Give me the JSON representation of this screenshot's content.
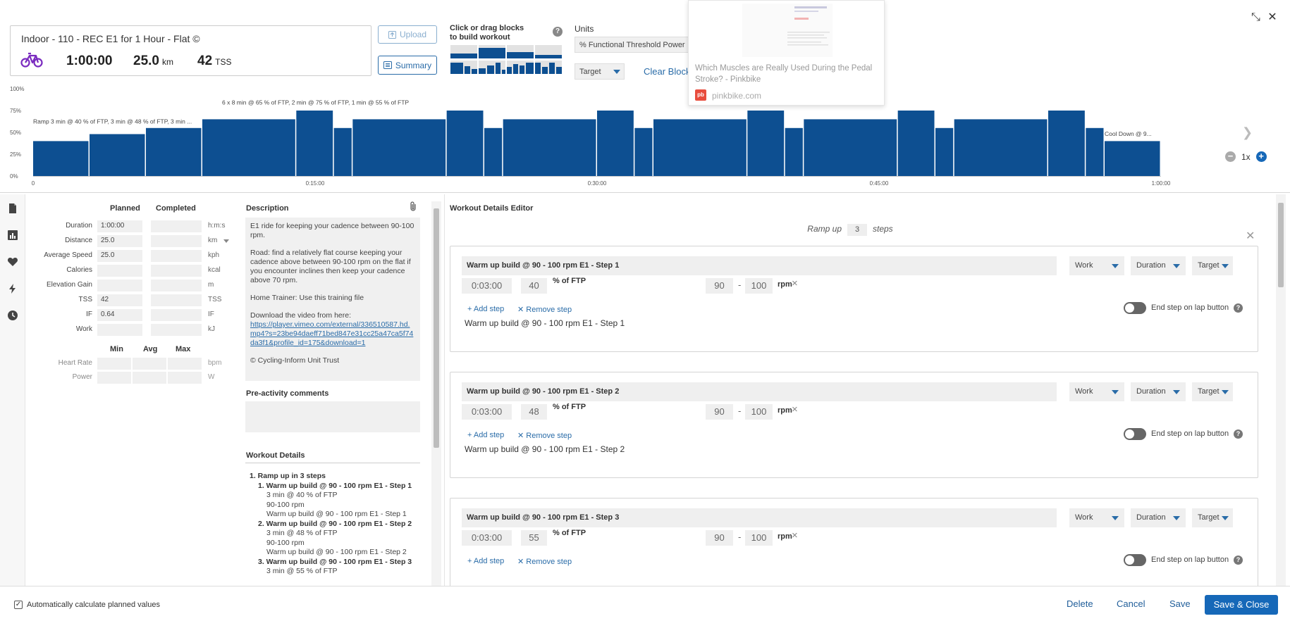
{
  "summary": {
    "title": "Indoor - 110 - REC E1 for 1 Hour - Flat ©",
    "duration": "1:00:00",
    "distance": "25.0",
    "distance_unit": "km",
    "tss": "42",
    "tss_unit": "TSS"
  },
  "toolbar": {
    "upload_label": "Upload",
    "summary_label": "Summary",
    "blocks_title_1": "Click or drag blocks",
    "blocks_title_2": "to build workout",
    "help": "?",
    "units_title": "Units",
    "units_value": "% Functional Threshold Power",
    "target_value": "Target",
    "clear_blocks": "Clear Blocks"
  },
  "link_preview": {
    "title": "Which Muscles are Really Used During the Pedal Stroke? - Pinkbike",
    "favicon": "pb",
    "domain": "pinkbike.com"
  },
  "window_icons": {
    "minimize": "⤡",
    "close": "✕"
  },
  "chart_data": {
    "type": "bar",
    "ylabel": "",
    "xlabel": "",
    "y_ticks": [
      "100%",
      "75%",
      "50%",
      "25%",
      "0%"
    ],
    "ylim": [
      0,
      100
    ],
    "xlim": [
      0,
      60
    ],
    "x_ticks": [
      {
        "v": 0,
        "label": "0"
      },
      {
        "v": 15,
        "label": "0:15:00"
      },
      {
        "v": 30,
        "label": "0:30:00"
      },
      {
        "v": 45,
        "label": "0:45:00"
      },
      {
        "v": 60,
        "label": "1:00:00"
      }
    ],
    "blocks": [
      {
        "start": 0,
        "end": 3,
        "value": 40
      },
      {
        "start": 3,
        "end": 6,
        "value": 48
      },
      {
        "start": 6,
        "end": 9,
        "value": 55
      },
      {
        "start": 9,
        "end": 14,
        "value": 65
      },
      {
        "start": 14,
        "end": 16,
        "value": 75
      },
      {
        "start": 16,
        "end": 17,
        "value": 55
      },
      {
        "start": 17,
        "end": 22,
        "value": 65
      },
      {
        "start": 22,
        "end": 24,
        "value": 75
      },
      {
        "start": 24,
        "end": 25,
        "value": 55
      },
      {
        "start": 25,
        "end": 30,
        "value": 65
      },
      {
        "start": 30,
        "end": 32,
        "value": 75
      },
      {
        "start": 32,
        "end": 33,
        "value": 55
      },
      {
        "start": 33,
        "end": 38,
        "value": 65
      },
      {
        "start": 38,
        "end": 40,
        "value": 75
      },
      {
        "start": 40,
        "end": 41,
        "value": 55
      },
      {
        "start": 41,
        "end": 46,
        "value": 65
      },
      {
        "start": 46,
        "end": 48,
        "value": 75
      },
      {
        "start": 48,
        "end": 49,
        "value": 55
      },
      {
        "start": 49,
        "end": 54,
        "value": 65
      },
      {
        "start": 54,
        "end": 56,
        "value": 75
      },
      {
        "start": 56,
        "end": 57,
        "value": 55
      },
      {
        "start": 57,
        "end": 60,
        "value": 40
      }
    ],
    "annotations": [
      {
        "text": "Ramp 3 min @ 40 % of FTP, 3 min @ 48 % of FTP, 3 min ...",
        "x": 0,
        "y": 60
      },
      {
        "text": "6 x 8 min @ 65 % of FTP, 2 min @ 75 % of FTP, 1 min @ 55 % of FTP",
        "x": 9,
        "y": 82
      },
      {
        "text": "Cool Down @ 9...",
        "x": 57,
        "y": 46
      }
    ],
    "zoom_label": "1x"
  },
  "stats": {
    "planned_head": "Planned",
    "completed_head": "Completed",
    "rows": [
      {
        "label": "Duration",
        "planned": "1:00:00",
        "unit": "h:m:s"
      },
      {
        "label": "Distance",
        "planned": "25.0",
        "unit": "km"
      },
      {
        "label": "Average Speed",
        "planned": "25.0",
        "unit": "kph"
      },
      {
        "label": "Calories",
        "planned": "",
        "unit": "kcal"
      },
      {
        "label": "Elevation Gain",
        "planned": "",
        "unit": "m"
      },
      {
        "label": "TSS",
        "planned": "42",
        "unit": "TSS"
      },
      {
        "label": "IF",
        "planned": "0.64",
        "unit": "IF"
      },
      {
        "label": "Work",
        "planned": "",
        "unit": "kJ"
      }
    ],
    "min_head": "Min",
    "avg_head": "Avg",
    "max_head": "Max",
    "hr_label": "Heart Rate",
    "hr_unit": "bpm",
    "power_label": "Power",
    "power_unit": "W"
  },
  "description": {
    "title": "Description",
    "p1": "E1 ride for keeping your cadence between 90-100 rpm.",
    "p2": "Road: find a relatively flat course keeping your cadence above between 90-100 rpm on the flat if you encounter inclines then keep your cadence above 70 rpm.",
    "p3": "Home Trainer: Use this training file",
    "p4": "Download the video from here:",
    "link": "https://player.vimeo.com/external/336510587.hd.mp4?s=23be94daeff71bed847e31cc25a47ca5f74da3f1&profile_id=175&download=1",
    "p5": "© Cycling-Inform Unit Trust",
    "pre_title": "Pre-activity comments",
    "details_title": "Workout Details",
    "details": {
      "l1": "1. Ramp up in 3 steps",
      "s1_title": "1. Warm up build @ 90 - 100 rpm E1 - Step 1",
      "s1_a": "3 min @ 40 % of FTP",
      "s1_b": "90-100 rpm",
      "s1_c": "Warm up build @ 90 - 100 rpm E1 - Step 1",
      "s2_title": "2. Warm up build @ 90 - 100 rpm E1 - Step 2",
      "s2_a": "3 min @ 48 % of FTP",
      "s2_b": "90-100 rpm",
      "s2_c": "Warm up build @ 90 - 100 rpm E1 - Step 2",
      "s3_title": "3. Warm up build @ 90 - 100 rpm E1 - Step 3",
      "s3_a": "3 min @ 55 % of FTP"
    }
  },
  "editor": {
    "title": "Workout Details Editor",
    "ramp_prefix": "Ramp up",
    "ramp_steps": "3",
    "ramp_suffix": "steps",
    "close": "✕",
    "steps": [
      {
        "name": "Warm up build @ 90 - 100 rpm E1 - Step 1",
        "type": "Work",
        "duration_sel": "Duration",
        "target_sel": "Target",
        "duration": "0:03:00",
        "pct": "40",
        "ftp": "% of FTP",
        "rpm_lo": "90",
        "rpm_hi": "100",
        "rpm_unit": "rpm",
        "add": "+ Add step",
        "remove": "✕ Remove step",
        "toggle_label": "End step on lap button",
        "desc": "Warm up build @ 90 - 100 rpm E1 - Step 1"
      },
      {
        "name": "Warm up build @ 90 - 100 rpm E1 - Step 2",
        "type": "Work",
        "duration_sel": "Duration",
        "target_sel": "Target",
        "duration": "0:03:00",
        "pct": "48",
        "ftp": "% of FTP",
        "rpm_lo": "90",
        "rpm_hi": "100",
        "rpm_unit": "rpm",
        "add": "+ Add step",
        "remove": "✕ Remove step",
        "toggle_label": "End step on lap button",
        "desc": "Warm up build @ 90 - 100 rpm E1 - Step 2"
      },
      {
        "name": "Warm up build @ 90 - 100 rpm E1 - Step 3",
        "type": "Work",
        "duration_sel": "Duration",
        "target_sel": "Target",
        "duration": "0:03:00",
        "pct": "55",
        "ftp": "% of FTP",
        "rpm_lo": "90",
        "rpm_hi": "100",
        "rpm_unit": "rpm",
        "add": "+ Add step",
        "remove": "✕ Remove step",
        "toggle_label": "End step on lap button",
        "desc": ""
      }
    ]
  },
  "footer": {
    "auto_calc": "Automatically calculate planned values",
    "delete": "Delete",
    "cancel": "Cancel",
    "save": "Save",
    "save_close": "Save & Close"
  },
  "colors": {
    "bar": "#0d4f91",
    "accent": "#1668b8",
    "link": "#2a6ca8",
    "bike": "#7a2bbf"
  }
}
